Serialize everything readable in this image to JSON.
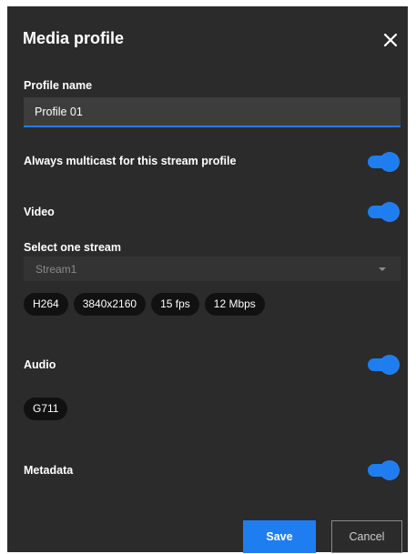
{
  "dialog": {
    "title": "Media profile",
    "close_icon": "close-icon"
  },
  "profile_name": {
    "label": "Profile name",
    "value": "Profile 01"
  },
  "multicast": {
    "label": "Always multicast for this stream profile",
    "enabled": true
  },
  "video": {
    "label": "Video",
    "enabled": true,
    "select_label": "Select one stream",
    "selected_stream": "Stream1",
    "chips": [
      "H264",
      "3840x2160",
      "15 fps",
      "12 Mbps"
    ]
  },
  "audio": {
    "label": "Audio",
    "enabled": true,
    "chips": [
      "G711"
    ]
  },
  "metadata": {
    "label": "Metadata",
    "enabled": true
  },
  "buttons": {
    "save": "Save",
    "cancel": "Cancel"
  },
  "colors": {
    "accent": "#1e7ef0",
    "dialog_bg": "#2b2b2b",
    "chip_bg": "#111111"
  }
}
